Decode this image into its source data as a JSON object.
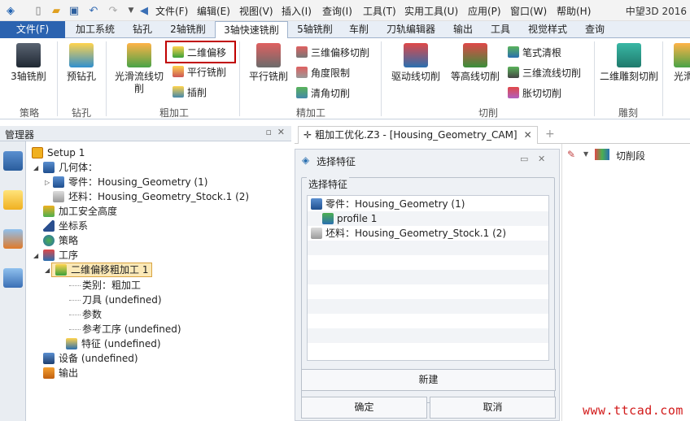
{
  "menu": [
    "文件(F)",
    "编辑(E)",
    "视图(V)",
    "插入(I)",
    "查询(I)",
    "工具(T)",
    "实用工具(U)",
    "应用(P)",
    "窗口(W)",
    "帮助(H)"
  ],
  "app_title": "中望3D 2016",
  "tabs": [
    "文件(F)",
    "加工系统",
    "钻孔",
    "2轴铣削",
    "3轴快速铣削",
    "5轴铣削",
    "车削",
    "刀轨编辑器",
    "输出",
    "工具",
    "视觉样式",
    "查询"
  ],
  "ribbon": {
    "mill3": "3轴铣削",
    "predrill": "预钻孔",
    "smooth_flow": "光滑流线切削",
    "offset2d": "二维偏移",
    "parallel": "平行铣削",
    "plunge": "插削",
    "parallel_finish": "平行铣削",
    "offset3d": "三维偏移切削",
    "angle_limit": "角度限制",
    "corner_clean": "清角切削",
    "drive_curve": "驱动线切削",
    "contour": "等高线切削",
    "pencil": "笔式清根",
    "flow3d": "三维流线切削",
    "bulge": "胀切切削",
    "engrave2d": "二维雕刻切削",
    "smooth_flow2": "光滑",
    "groups": [
      "策略",
      "钻孔",
      "粗加工",
      "精加工",
      "切削",
      "雕刻"
    ]
  },
  "manager": {
    "title": "管理器",
    "tree": {
      "setup": "Setup 1",
      "geometry": "几何体：",
      "part": "零件：Housing_Geometry (1)",
      "stock": "坯料：Housing_Geometry_Stock.1 (2)",
      "safe_height": "加工安全高度",
      "coord": "坐标系",
      "strategy": "策略",
      "process": "工序",
      "op": "二维偏移粗加工 1",
      "category": "类别：粗加工",
      "tool": "刀具 (undefined)",
      "params": "参数",
      "ref_op": "参考工序 (undefined)",
      "feature": "特征 (undefined)",
      "device": "设备 (undefined)",
      "output": "输出"
    }
  },
  "doc_tab": "粗加工优化.Z3 - [Housing_Geometry_CAM]",
  "dialog": {
    "title": "选择特征",
    "group_label": "选择特征",
    "items": [
      "零件：Housing_Geometry (1)",
      "profile 1",
      "坯料：Housing_Geometry_Stock.1 (2)"
    ],
    "new_btn": "新建",
    "ok_btn": "确定",
    "cancel_btn": "取消"
  },
  "right_panel": {
    "filter": "切削段"
  },
  "watermark": "www.ttcad.com"
}
